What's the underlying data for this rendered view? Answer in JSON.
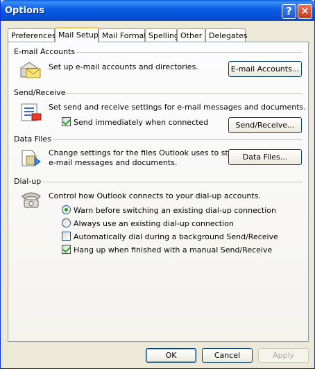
{
  "window": {
    "title": "Options",
    "help_glyph": "?",
    "close_glyph": "✕"
  },
  "tabs": [
    {
      "label": "Preferences"
    },
    {
      "label": "Mail Setup",
      "active": true
    },
    {
      "label": "Mail Format"
    },
    {
      "label": "Spelling"
    },
    {
      "label": "Other"
    },
    {
      "label": "Delegates"
    }
  ],
  "sections": {
    "email_accounts": {
      "heading": "E-mail Accounts",
      "description": "Set up e-mail accounts and directories.",
      "button": "E-mail Accounts...",
      "icon": "email-accounts-icon"
    },
    "send_receive": {
      "heading": "Send/Receive",
      "description": "Set send and receive settings for e-mail messages and documents.",
      "checkbox": {
        "label": "Send immediately when connected",
        "checked": true
      },
      "button": "Send/Receive...",
      "icon": "send-receive-icon"
    },
    "data_files": {
      "heading": "Data Files",
      "description_line1": "Change settings for the files Outlook uses to store",
      "description_line2": "e-mail messages and documents.",
      "button": "Data Files...",
      "icon": "data-files-icon"
    },
    "dialup": {
      "heading": "Dial-up",
      "description": "Control how Outlook connects to your dial-up accounts.",
      "radio_warn": {
        "label": "Warn before switching an existing dial-up connection",
        "selected": true
      },
      "radio_always": {
        "label": "Always use an existing dial-up connection",
        "selected": false
      },
      "check_auto": {
        "label": "Automatically dial during a background Send/Receive",
        "checked": false
      },
      "check_hangup": {
        "label": "Hang up when finished with a manual Send/Receive",
        "checked": true
      },
      "icon": "dialup-phone-icon"
    }
  },
  "footer": {
    "ok": "OK",
    "cancel": "Cancel",
    "apply": "Apply"
  },
  "colors": {
    "titlebar": "#0550d6",
    "active_tab_accent": "#ffc83c",
    "check_green": "#21a121"
  }
}
